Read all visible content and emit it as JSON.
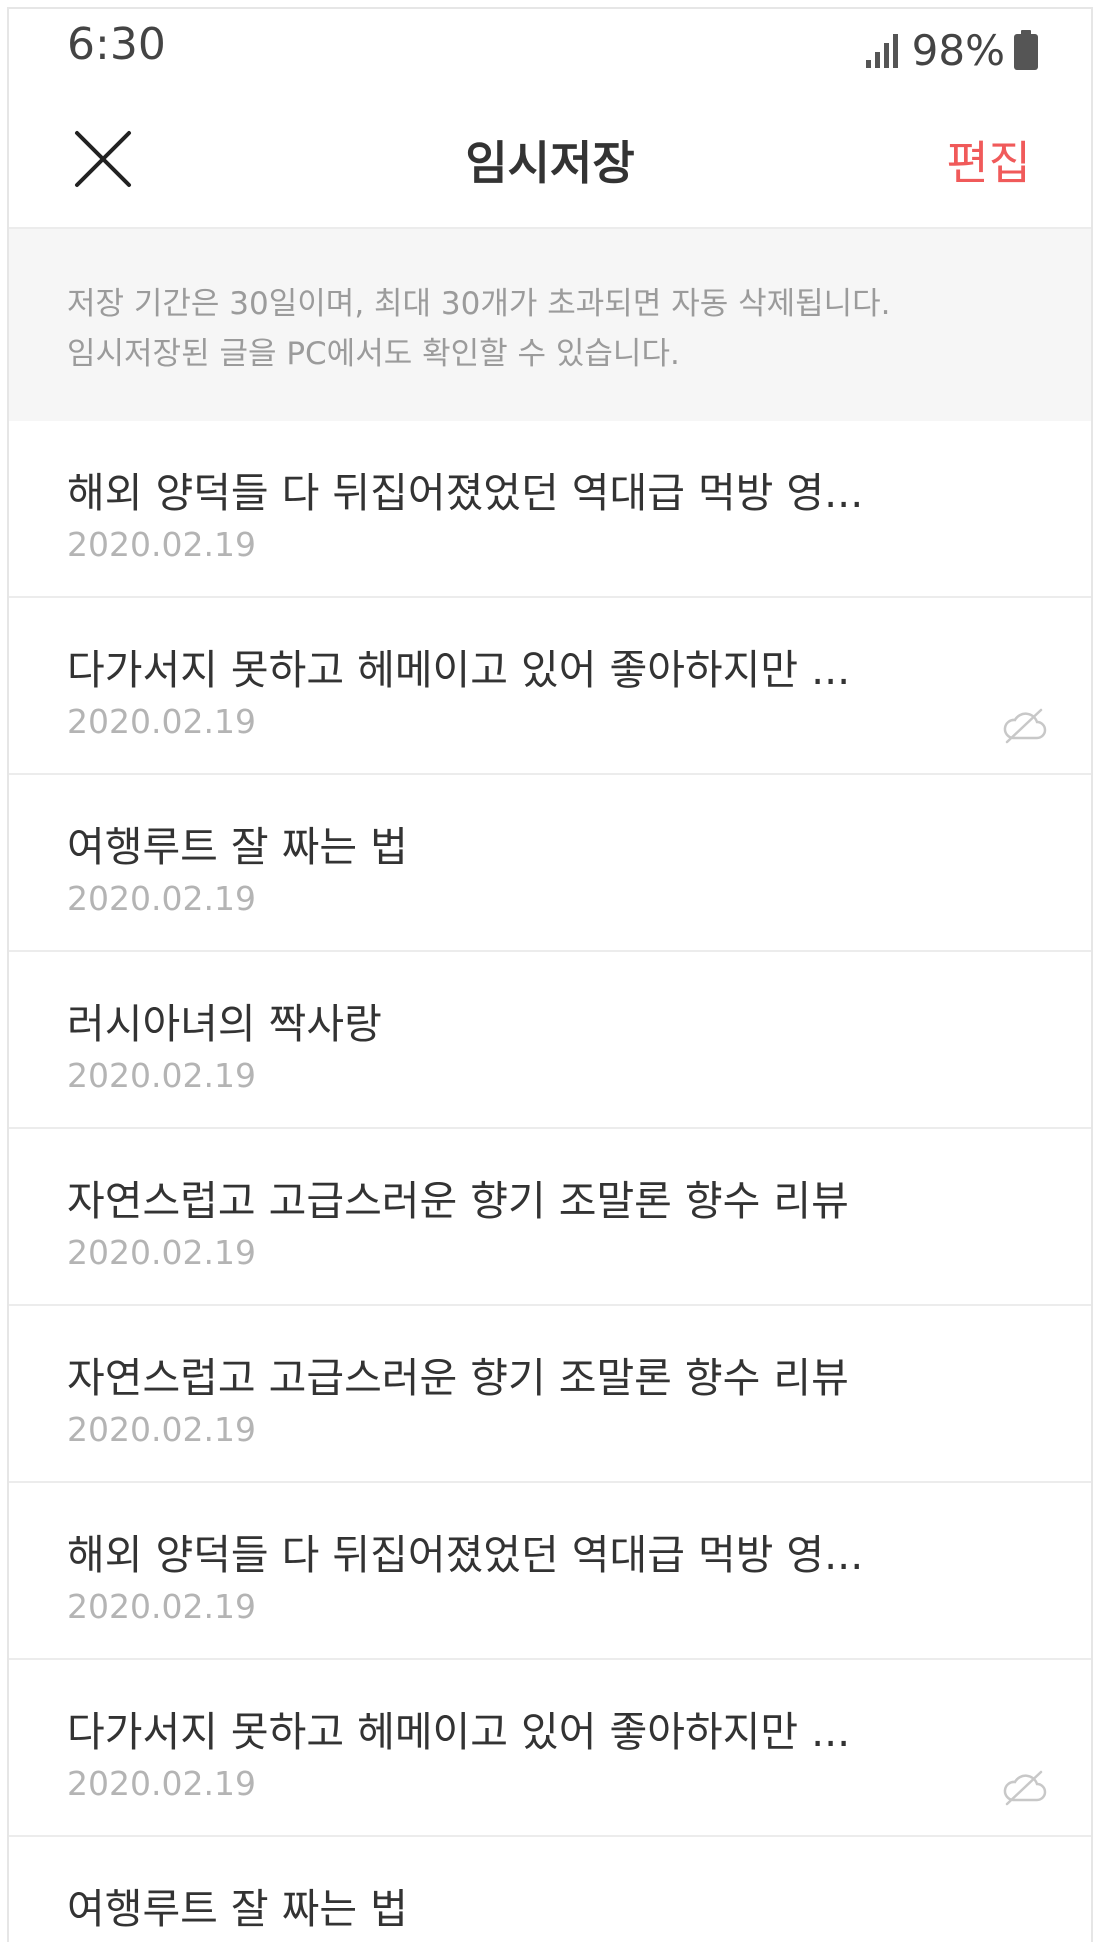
{
  "status_bar": {
    "time": "6:30",
    "battery": "98%",
    "icons": [
      "signal-icon",
      "battery-icon"
    ]
  },
  "header": {
    "close_icon": "close-icon",
    "title": "임시저장",
    "edit_label": "편집",
    "accent_color": "#f05a5a"
  },
  "notice": {
    "line1": "저장 기간은 30일이며, 최대 30개가 초과되면 자동 삭제됩니다.",
    "line2": "임시저장된 글을 PC에서도 확인할 수 있습니다."
  },
  "drafts": [
    {
      "title": "해외 양덕들 다 뒤집어졌었던 역대급 먹방 영...",
      "date": "2020.02.19",
      "sync_off": false
    },
    {
      "title": "다가서지 못하고 헤메이고 있어 좋아하지만 ...",
      "date": "2020.02.19",
      "sync_off": true
    },
    {
      "title": "여행루트 잘 짜는 법",
      "date": "2020.02.19",
      "sync_off": false
    },
    {
      "title": "러시아녀의 짝사랑",
      "date": "2020.02.19",
      "sync_off": false
    },
    {
      "title": "자연스럽고 고급스러운 향기 조말론 향수 리뷰",
      "date": "2020.02.19",
      "sync_off": false
    },
    {
      "title": "자연스럽고 고급스러운 향기 조말론 향수 리뷰",
      "date": "2020.02.19",
      "sync_off": false
    },
    {
      "title": "해외 양덕들 다 뒤집어졌었던 역대급 먹방 영...",
      "date": "2020.02.19",
      "sync_off": false
    },
    {
      "title": "다가서지 못하고 헤메이고 있어 좋아하지만 ...",
      "date": "2020.02.19",
      "sync_off": true
    },
    {
      "title": "여행루트 잘 짜는 법",
      "date": "",
      "sync_off": false
    }
  ]
}
